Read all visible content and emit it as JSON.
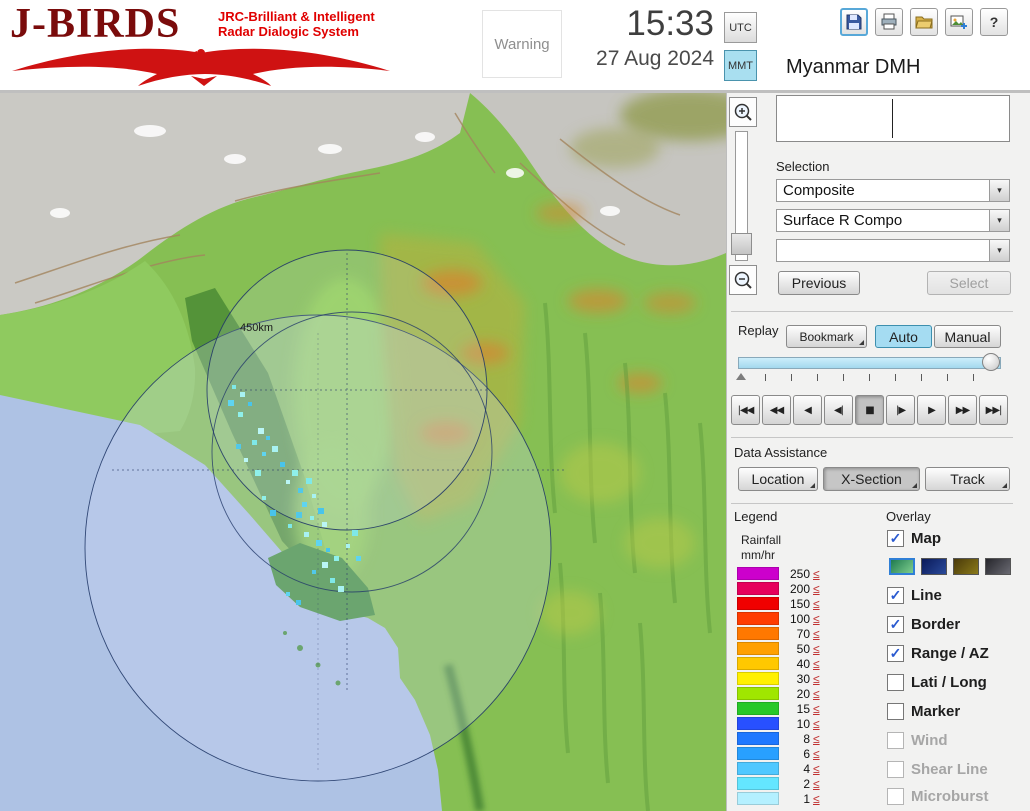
{
  "header": {
    "logo": {
      "title": "J-BIRDS",
      "tagline1": "JRC-Brilliant & Intelligent",
      "tagline2": "Radar  Dialogic  System"
    },
    "warning_label": "Warning",
    "clock": {
      "time": "15:33",
      "date": "27 Aug 2024"
    },
    "timezone": {
      "options": [
        "UTC",
        "MMT"
      ],
      "selected": "MMT"
    },
    "toolbar_icons": [
      "save-icon",
      "print-icon",
      "open-folder-icon",
      "capture-icon",
      "help-icon"
    ],
    "org_name": "Myanmar DMH"
  },
  "zoom": {
    "in_icon": "zoom-in-icon",
    "out_icon": "zoom-out-icon"
  },
  "selection": {
    "label": "Selection",
    "arrow": "▾",
    "dropdowns": [
      {
        "value": "Composite"
      },
      {
        "value": "Surface R Compo"
      },
      {
        "value": ""
      }
    ],
    "previous": "Previous",
    "select": "Select"
  },
  "replay": {
    "label": "Replay",
    "bookmark": "Bookmark",
    "auto": "Auto",
    "manual": "Manual",
    "selected_mode": "Auto",
    "playback": [
      "|◀◀",
      "◀◀",
      "◀",
      "◀|",
      "■",
      "|▶",
      "▶",
      "▶▶",
      "▶▶|"
    ],
    "pressed_index": 4
  },
  "data_assistance": {
    "label": "Data Assistance",
    "buttons": [
      {
        "label": "Location",
        "active": false
      },
      {
        "label": "X-Section",
        "active": true
      },
      {
        "label": "Track",
        "active": false
      }
    ]
  },
  "legend": {
    "label": "Legend",
    "unit_line1": "Rainfall",
    "unit_line2": "mm/hr",
    "operator": "≤",
    "entries": [
      {
        "value": "250",
        "color": "#cc00cc"
      },
      {
        "value": "200",
        "color": "#e6005c"
      },
      {
        "value": "150",
        "color": "#f00000"
      },
      {
        "value": "100",
        "color": "#ff3c00"
      },
      {
        "value": "70",
        "color": "#ff7800"
      },
      {
        "value": "50",
        "color": "#ffa000"
      },
      {
        "value": "40",
        "color": "#ffc800"
      },
      {
        "value": "30",
        "color": "#fff000"
      },
      {
        "value": "20",
        "color": "#a0e600"
      },
      {
        "value": "15",
        "color": "#28c828"
      },
      {
        "value": "10",
        "color": "#2850ff"
      },
      {
        "value": "8",
        "color": "#1e78ff"
      },
      {
        "value": "6",
        "color": "#28a0ff"
      },
      {
        "value": "4",
        "color": "#50c8ff"
      },
      {
        "value": "2",
        "color": "#64e6ff"
      },
      {
        "value": "1",
        "color": "#b4f0ff"
      }
    ]
  },
  "overlay": {
    "label": "Overlay",
    "items": [
      {
        "label": "Map",
        "checked": true,
        "enabled": true
      },
      {
        "label": "Line",
        "checked": true,
        "enabled": true
      },
      {
        "label": "Border",
        "checked": true,
        "enabled": true
      },
      {
        "label": "Range / AZ",
        "checked": true,
        "enabled": true
      },
      {
        "label": "Lati / Long",
        "checked": false,
        "enabled": true
      },
      {
        "label": "Marker",
        "checked": false,
        "enabled": true
      },
      {
        "label": "Wind",
        "checked": false,
        "enabled": false
      },
      {
        "label": "Shear Line",
        "checked": false,
        "enabled": false
      },
      {
        "label": "Microburst",
        "checked": false,
        "enabled": false
      }
    ],
    "map_styles": [
      {
        "name": "terrain-green",
        "c1": "#1f7a4f",
        "c2": "#7fcf8f",
        "selected": true
      },
      {
        "name": "dark-navy",
        "c1": "#0a1a5a",
        "c2": "#2a4a9a",
        "selected": false
      },
      {
        "name": "dark-olive",
        "c1": "#4a3a0a",
        "c2": "#8a7a1a",
        "selected": false
      },
      {
        "name": "dark-gray",
        "c1": "#26262c",
        "c2": "#6a6a72",
        "selected": false
      }
    ]
  },
  "map": {
    "range_ring_label": "450km"
  }
}
